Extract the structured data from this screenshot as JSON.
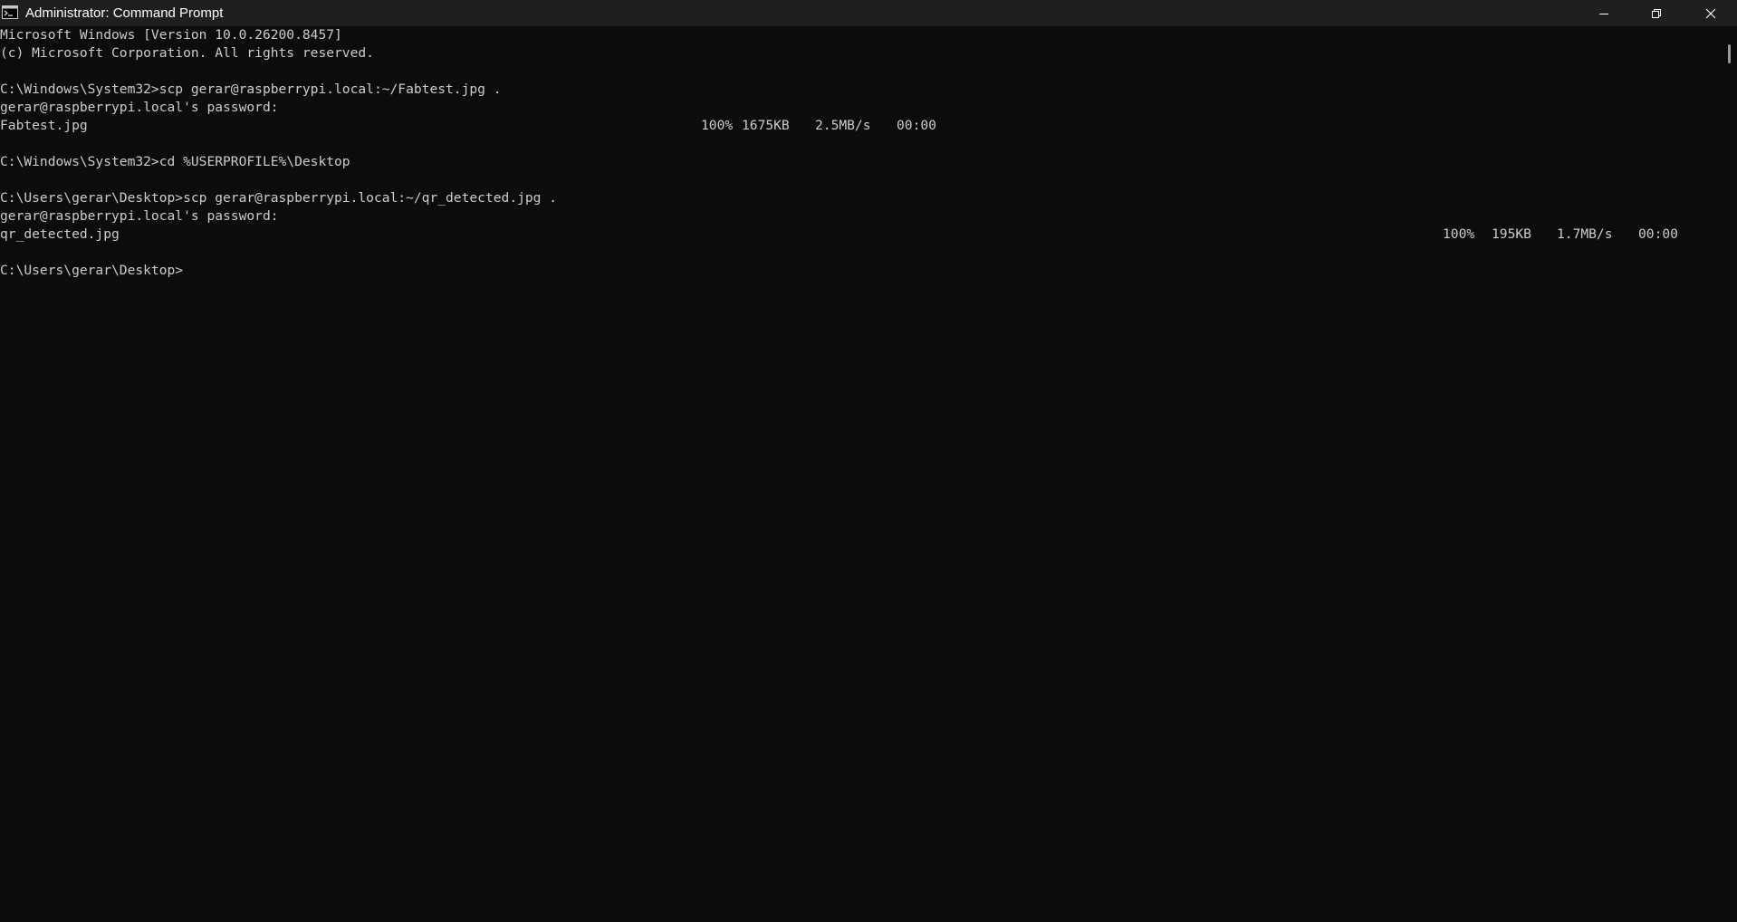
{
  "window": {
    "title": "Administrator: Command Prompt",
    "app_icon": "cmd-icon",
    "controls": {
      "minimize_icon": "minimize-icon",
      "maximize_icon": "restore-icon",
      "close_icon": "close-icon"
    }
  },
  "colors": {
    "background": "#0c0c0c",
    "titlebar": "#1f1f1f",
    "text": "#cccccc",
    "title_text": "#ffffff"
  },
  "terminal": {
    "lines": [
      "Microsoft Windows [Version 10.0.26200.8457]",
      "(c) Microsoft Corporation. All rights reserved.",
      "C:\\Windows\\System32>scp gerar@raspberrypi.local:~/Fabtest.jpg .",
      "gerar@raspberrypi.local's password:",
      "C:\\Windows\\System32>cd %USERPROFILE%\\Desktop",
      "C:\\Users\\gerar\\Desktop>scp gerar@raspberrypi.local:~/qr_detected.jpg .",
      "gerar@raspberrypi.local's password:",
      "C:\\Users\\gerar\\Desktop>"
    ],
    "transfers": [
      {
        "file": "Fabtest.jpg",
        "percent": "100%",
        "size": "1675KB",
        "rate": "2.5MB/s",
        "eta": "00:00"
      },
      {
        "file": "qr_detected.jpg",
        "percent": "100%",
        "size": "195KB",
        "rate": "1.7MB/s",
        "eta": "00:00"
      }
    ]
  }
}
